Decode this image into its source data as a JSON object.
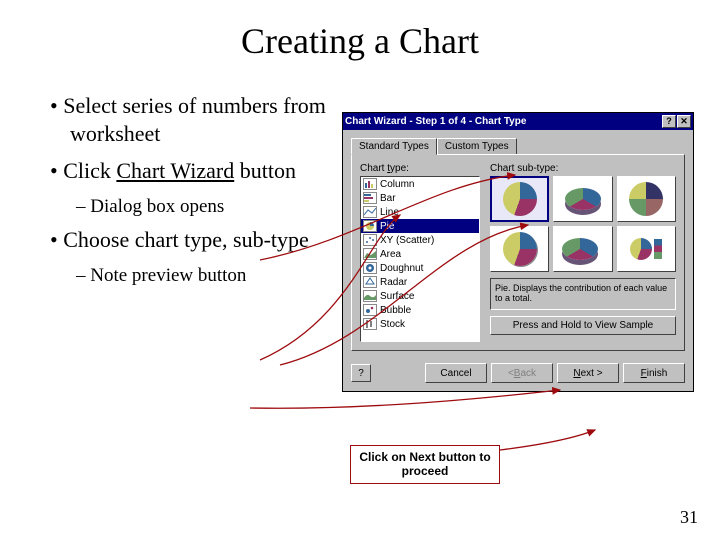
{
  "title": "Creating a Chart",
  "bullets": {
    "b1": "Select series of numbers from worksheet",
    "b2_pre": "Click ",
    "b2_link": "Chart Wizard",
    "b2_post": " button",
    "b2_sub": "Dialog box opens",
    "b3": "Choose chart type, sub-type",
    "b3_sub": "Note preview button"
  },
  "dialog": {
    "title": "Chart Wizard - Step 1 of 4 - Chart Type",
    "help_glyph": "?",
    "close_glyph": "✕",
    "tabs": {
      "std": "Standard Types",
      "custom": "Custom Types"
    },
    "labels": {
      "type": "Chart type:",
      "subtype": "Chart sub-type:"
    },
    "types": [
      "Column",
      "Bar",
      "Line",
      "Pie",
      "XY (Scatter)",
      "Area",
      "Doughnut",
      "Radar",
      "Surface",
      "Bubble",
      "Stock"
    ],
    "selected_type": "Pie",
    "desc": "Pie. Displays the contribution of each value to a total.",
    "preview_btn": "Press and Hold to View Sample",
    "buttons": {
      "cancel": "Cancel",
      "back": "< Back",
      "next": "Next >",
      "finish": "Finish"
    },
    "help_btn": "?"
  },
  "callout": "Click on Next button to proceed",
  "page_number": "31",
  "colors": {
    "accent": "#9e0b0e",
    "titlebar": "#000080"
  }
}
